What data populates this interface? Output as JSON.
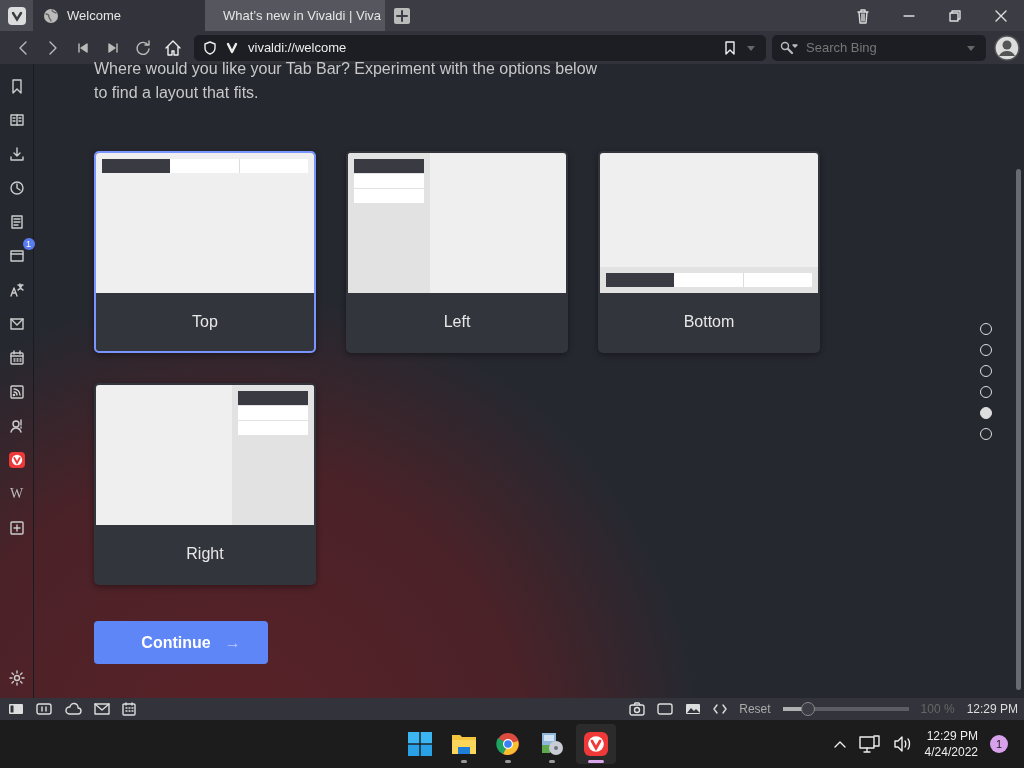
{
  "tabs": [
    {
      "title": "Welcome",
      "kind": "globe",
      "selected": true
    },
    {
      "title": "What’s new in Vivaldi | Viva",
      "kind": "vivaldi",
      "selected": false
    }
  ],
  "address": {
    "url": "vivaldi://welcome"
  },
  "search": {
    "placeholder": "Search Bing"
  },
  "panel": {
    "items": [
      {
        "kind": "bookmark"
      },
      {
        "kind": "reader"
      },
      {
        "kind": "download"
      },
      {
        "kind": "history"
      },
      {
        "kind": "notes"
      },
      {
        "kind": "window",
        "badge": "1"
      },
      {
        "kind": "translate"
      },
      {
        "kind": "mail"
      },
      {
        "kind": "calendar"
      },
      {
        "kind": "feed"
      },
      {
        "kind": "contacts"
      },
      {
        "kind": "vivaldi"
      },
      {
        "kind": "glyph",
        "glyph": "W"
      },
      {
        "kind": "add"
      }
    ]
  },
  "intro": "Where would you like your Tab Bar? Experiment with the options below to find a layout that fits.",
  "layouts": [
    {
      "label": "Top",
      "kind": "top",
      "selected": true
    },
    {
      "label": "Left",
      "kind": "left",
      "selected": false
    },
    {
      "label": "Bottom",
      "kind": "bottom",
      "selected": false
    },
    {
      "label": "Right",
      "kind": "right",
      "selected": false
    }
  ],
  "continue_button": {
    "label": "Continue",
    "arrow": "→"
  },
  "steps": [
    {
      "selected": false
    },
    {
      "selected": false
    },
    {
      "selected": false
    },
    {
      "selected": false
    },
    {
      "selected": true
    },
    {
      "selected": false
    }
  ],
  "status_bar": {
    "reset": "Reset",
    "zoom": {
      "level": 0.2
    },
    "zoom_reading": "100 %",
    "clock": "12:29 PM"
  },
  "taskbar": {
    "apps": [
      {
        "kind": "start",
        "running": false,
        "active": false
      },
      {
        "kind": "folder",
        "running": true,
        "active": false
      },
      {
        "kind": "chrome",
        "running": true,
        "active": false
      },
      {
        "kind": "installer",
        "running": true,
        "active": false
      },
      {
        "kind": "vivaldi",
        "running": true,
        "active": true
      }
    ],
    "time": "12:29 PM",
    "date": "4/24/2022",
    "notifications": "1"
  }
}
